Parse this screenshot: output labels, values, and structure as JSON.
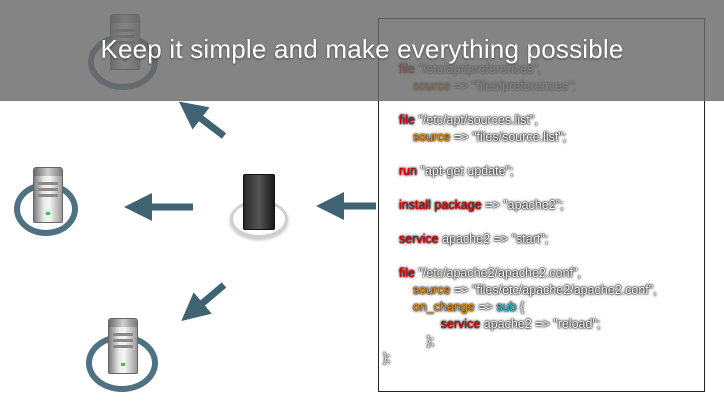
{
  "banner": {
    "title": "Keep it simple and make everything possible"
  },
  "code": {
    "lines": [
      {
        "parts": [
          {
            "t": "file ",
            "c": "kw"
          },
          {
            "t": "\"/etc/apt/preferences\",",
            "c": "wt"
          }
        ]
      },
      {
        "parts": [
          {
            "t": "    source",
            "c": "opt"
          },
          {
            "t": " => \"files/preferences\";",
            "c": "wt"
          }
        ]
      },
      {
        "parts": []
      },
      {
        "parts": [
          {
            "t": "file ",
            "c": "kw"
          },
          {
            "t": "\"/etc/apt/sources.list\",",
            "c": "wt"
          }
        ]
      },
      {
        "parts": [
          {
            "t": "    source",
            "c": "opt"
          },
          {
            "t": " => \"files/source.list\";",
            "c": "wt"
          }
        ]
      },
      {
        "parts": []
      },
      {
        "parts": [
          {
            "t": "run ",
            "c": "kw"
          },
          {
            "t": "\"apt-get update\";",
            "c": "wt"
          }
        ]
      },
      {
        "parts": []
      },
      {
        "parts": [
          {
            "t": "install package",
            "c": "kw"
          },
          {
            "t": " => \"apache2\";",
            "c": "wt"
          }
        ]
      },
      {
        "parts": []
      },
      {
        "parts": [
          {
            "t": "service ",
            "c": "kw"
          },
          {
            "t": "apache2 => \"start\";",
            "c": "wt"
          }
        ]
      },
      {
        "parts": []
      },
      {
        "parts": [
          {
            "t": "file ",
            "c": "kw"
          },
          {
            "t": "\"/etc/apache2/apache2.conf\",",
            "c": "wt"
          }
        ]
      },
      {
        "parts": [
          {
            "t": "    source",
            "c": "opt"
          },
          {
            "t": " => \"files/etc/apache2/apache2.conf\",",
            "c": "wt"
          }
        ]
      },
      {
        "parts": [
          {
            "t": "    on_change",
            "c": "opt"
          },
          {
            "t": " => ",
            "c": "wt"
          },
          {
            "t": "sub",
            "c": "cy"
          },
          {
            "t": " {",
            "c": "wt"
          }
        ]
      },
      {
        "parts": [
          {
            "t": "            service ",
            "c": "kw"
          },
          {
            "t": "apache2 => \"reload\";",
            "c": "wt"
          }
        ]
      },
      {
        "parts": [
          {
            "t": "        };",
            "c": "wt"
          }
        ]
      },
      {
        "parts": [
          {
            "t": "};",
            "c": "wt"
          }
        ]
      }
    ]
  },
  "colors": {
    "arrow": "#3f6372",
    "ring": "#4f7282",
    "keyword": "#e60000",
    "option": "#f39200",
    "sub": "#29c7e6"
  }
}
